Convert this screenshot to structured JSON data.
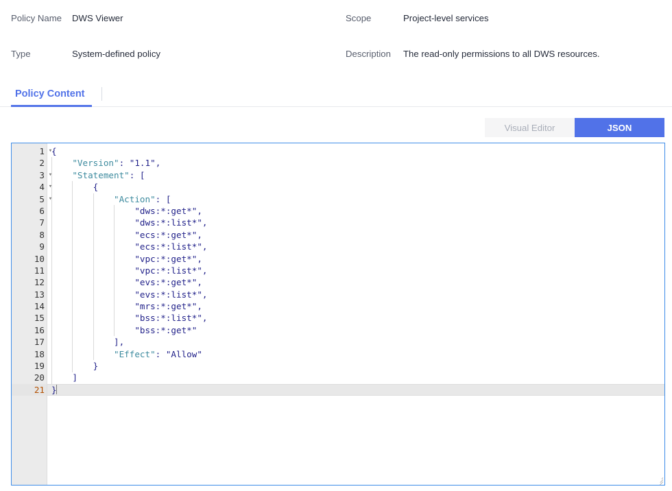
{
  "details": {
    "rows": [
      {
        "left": {
          "label": "Policy Name",
          "value": "DWS Viewer"
        },
        "right": {
          "label": "Scope",
          "value": "Project-level services"
        }
      },
      {
        "left": {
          "label": "Type",
          "value": "System-defined policy"
        },
        "right": {
          "label": "Description",
          "value": "The read-only permissions to all DWS resources."
        }
      }
    ]
  },
  "tabs": {
    "items": [
      {
        "label": "Policy Content",
        "active": true
      }
    ]
  },
  "mode_toggle": {
    "visual_editor_label": "Visual Editor",
    "json_label": "JSON",
    "selected": "JSON",
    "active_color": "#5172e8",
    "inactive_bg": "#f5f5f6",
    "inactive_text": "#a8adb8"
  },
  "editor": {
    "border_color": "#3d8ce8",
    "gutter_bg": "#ebebeb",
    "active_line": 21,
    "key_color": "#3c8a9e",
    "string_color": "#22228a",
    "lines": [
      {
        "n": 1,
        "fold": true,
        "indent": 0,
        "segs": [
          {
            "t": "{",
            "c": "p"
          }
        ]
      },
      {
        "n": 2,
        "fold": false,
        "indent": 1,
        "segs": [
          {
            "t": "    ",
            "c": "p"
          },
          {
            "t": "\"Version\"",
            "c": "k"
          },
          {
            "t": ": ",
            "c": "p"
          },
          {
            "t": "\"1.1\"",
            "c": "s"
          },
          {
            "t": ",",
            "c": "p"
          }
        ]
      },
      {
        "n": 3,
        "fold": true,
        "indent": 1,
        "segs": [
          {
            "t": "    ",
            "c": "p"
          },
          {
            "t": "\"Statement\"",
            "c": "k"
          },
          {
            "t": ": [",
            "c": "p"
          }
        ]
      },
      {
        "n": 4,
        "fold": true,
        "indent": 2,
        "segs": [
          {
            "t": "        {",
            "c": "p"
          }
        ]
      },
      {
        "n": 5,
        "fold": true,
        "indent": 3,
        "segs": [
          {
            "t": "            ",
            "c": "p"
          },
          {
            "t": "\"Action\"",
            "c": "k"
          },
          {
            "t": ": [",
            "c": "p"
          }
        ]
      },
      {
        "n": 6,
        "fold": false,
        "indent": 4,
        "segs": [
          {
            "t": "                ",
            "c": "p"
          },
          {
            "t": "\"dws:*:get*\"",
            "c": "s"
          },
          {
            "t": ",",
            "c": "p"
          }
        ]
      },
      {
        "n": 7,
        "fold": false,
        "indent": 4,
        "segs": [
          {
            "t": "                ",
            "c": "p"
          },
          {
            "t": "\"dws:*:list*\"",
            "c": "s"
          },
          {
            "t": ",",
            "c": "p"
          }
        ]
      },
      {
        "n": 8,
        "fold": false,
        "indent": 4,
        "segs": [
          {
            "t": "                ",
            "c": "p"
          },
          {
            "t": "\"ecs:*:get*\"",
            "c": "s"
          },
          {
            "t": ",",
            "c": "p"
          }
        ]
      },
      {
        "n": 9,
        "fold": false,
        "indent": 4,
        "segs": [
          {
            "t": "                ",
            "c": "p"
          },
          {
            "t": "\"ecs:*:list*\"",
            "c": "s"
          },
          {
            "t": ",",
            "c": "p"
          }
        ]
      },
      {
        "n": 10,
        "fold": false,
        "indent": 4,
        "segs": [
          {
            "t": "                ",
            "c": "p"
          },
          {
            "t": "\"vpc:*:get*\"",
            "c": "s"
          },
          {
            "t": ",",
            "c": "p"
          }
        ]
      },
      {
        "n": 11,
        "fold": false,
        "indent": 4,
        "segs": [
          {
            "t": "                ",
            "c": "p"
          },
          {
            "t": "\"vpc:*:list*\"",
            "c": "s"
          },
          {
            "t": ",",
            "c": "p"
          }
        ]
      },
      {
        "n": 12,
        "fold": false,
        "indent": 4,
        "segs": [
          {
            "t": "                ",
            "c": "p"
          },
          {
            "t": "\"evs:*:get*\"",
            "c": "s"
          },
          {
            "t": ",",
            "c": "p"
          }
        ]
      },
      {
        "n": 13,
        "fold": false,
        "indent": 4,
        "segs": [
          {
            "t": "                ",
            "c": "p"
          },
          {
            "t": "\"evs:*:list*\"",
            "c": "s"
          },
          {
            "t": ",",
            "c": "p"
          }
        ]
      },
      {
        "n": 14,
        "fold": false,
        "indent": 4,
        "segs": [
          {
            "t": "                ",
            "c": "p"
          },
          {
            "t": "\"mrs:*:get*\"",
            "c": "s"
          },
          {
            "t": ",",
            "c": "p"
          }
        ]
      },
      {
        "n": 15,
        "fold": false,
        "indent": 4,
        "segs": [
          {
            "t": "                ",
            "c": "p"
          },
          {
            "t": "\"bss:*:list*\"",
            "c": "s"
          },
          {
            "t": ",",
            "c": "p"
          }
        ]
      },
      {
        "n": 16,
        "fold": false,
        "indent": 4,
        "segs": [
          {
            "t": "                ",
            "c": "p"
          },
          {
            "t": "\"bss:*:get*\"",
            "c": "s"
          }
        ]
      },
      {
        "n": 17,
        "fold": false,
        "indent": 3,
        "segs": [
          {
            "t": "            ],",
            "c": "p"
          }
        ]
      },
      {
        "n": 18,
        "fold": false,
        "indent": 3,
        "segs": [
          {
            "t": "            ",
            "c": "p"
          },
          {
            "t": "\"Effect\"",
            "c": "k"
          },
          {
            "t": ": ",
            "c": "p"
          },
          {
            "t": "\"Allow\"",
            "c": "s"
          }
        ]
      },
      {
        "n": 19,
        "fold": false,
        "indent": 2,
        "segs": [
          {
            "t": "        }",
            "c": "p"
          }
        ]
      },
      {
        "n": 20,
        "fold": false,
        "indent": 1,
        "segs": [
          {
            "t": "    ]",
            "c": "p"
          }
        ]
      },
      {
        "n": 21,
        "fold": false,
        "indent": 0,
        "segs": [
          {
            "t": "}",
            "c": "p"
          }
        ]
      }
    ]
  }
}
